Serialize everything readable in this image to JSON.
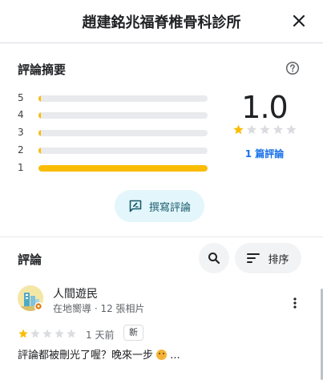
{
  "header": {
    "title": "趙建銘兆福脊椎骨科診所",
    "close_icon": "close-icon"
  },
  "summary": {
    "title": "評論摘要",
    "help_icon": "help-circle-icon",
    "distribution": [
      {
        "stars": "5",
        "fraction": 0.0
      },
      {
        "stars": "4",
        "fraction": 0.0
      },
      {
        "stars": "3",
        "fraction": 0.0
      },
      {
        "stars": "2",
        "fraction": 0.0
      },
      {
        "stars": "1",
        "fraction": 1.0
      }
    ],
    "average": "1.0",
    "average_stars": 1,
    "review_count_label": "1 篇評論",
    "star_color": "#fbbc04",
    "star_empty_color": "#dadce0"
  },
  "write_review": {
    "label": "撰寫評論",
    "icon": "rate-review-icon"
  },
  "reviews": {
    "title": "評論",
    "search_icon": "search-icon",
    "sort_label": "排序",
    "sort_icon": "sort-icon",
    "items": [
      {
        "name": "人間遊民",
        "meta": "在地嚮導 · 12 張相片",
        "stars": 1,
        "time": "1 天前",
        "badge": "新",
        "text": "評論都被刪光了喔？晚來一步",
        "text_suffix": " ..."
      }
    ]
  }
}
